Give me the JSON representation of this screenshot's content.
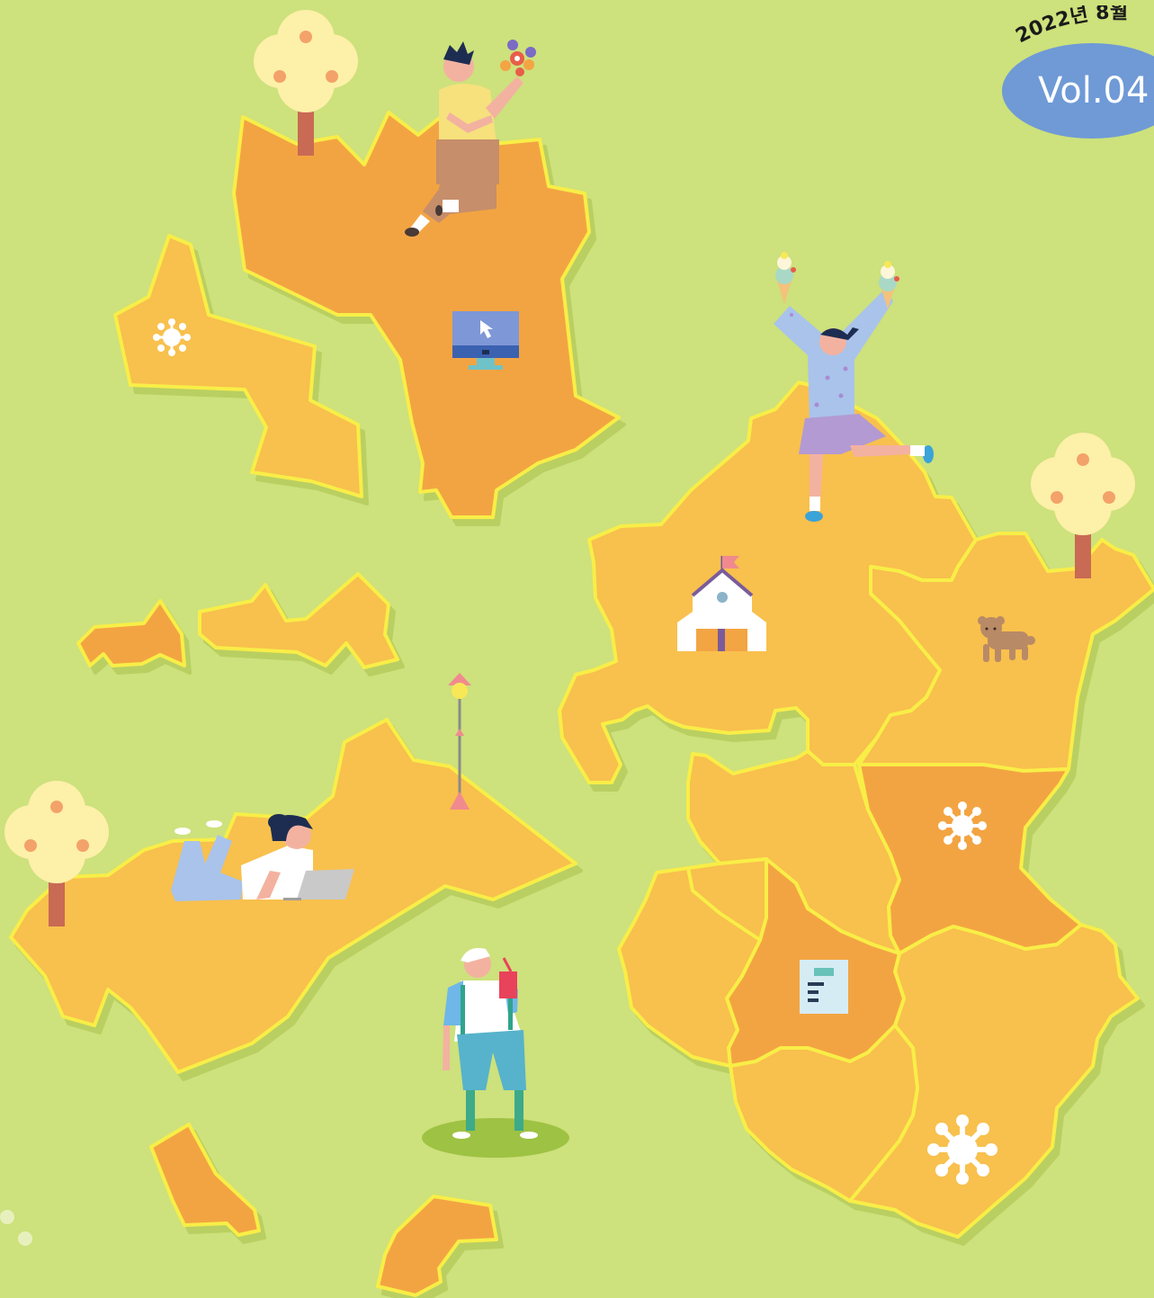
{
  "issue": {
    "date_text": "2022년 8월",
    "volume_text": "Vol.04"
  },
  "colors": {
    "background": "#cde17c",
    "region_light": "#f8c04d",
    "region_dark": "#f3a443",
    "region_outline": "#f8ee47",
    "badge": "#6f9ad6"
  },
  "icons": [
    "monitor-cursor-icon",
    "school-house-icon",
    "document-icon",
    "lamp-post-icon",
    "sparkle-icon",
    "tree-icon",
    "dog-icon"
  ]
}
